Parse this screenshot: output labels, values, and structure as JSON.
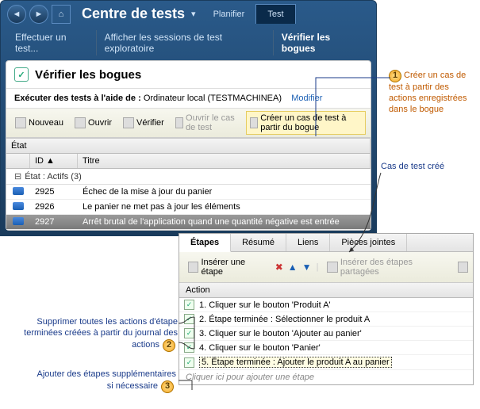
{
  "header": {
    "title": "Centre de tests",
    "tabs": [
      "Planifier",
      "Test"
    ],
    "active_tab": "Test"
  },
  "subnav": {
    "items": [
      "Effectuer un test...",
      "Afficher les sessions de test exploratoire",
      "Vérifier les bogues"
    ],
    "active": "Vérifier les bogues"
  },
  "panel": {
    "title": "Vérifier les bogues",
    "run_label": "Exécuter des tests à l'aide de :",
    "run_value": "Ordinateur local (TESTMACHINEA)",
    "modify": "Modifier"
  },
  "toolbar": {
    "new": "Nouveau",
    "open": "Ouvrir",
    "verify": "Vérifier",
    "open_case": "Ouvrir le cas de test",
    "create_case": "Créer un cas de test à partir du bogue"
  },
  "grid": {
    "state_hdr": "État",
    "cols": [
      "",
      "ID",
      "Titre"
    ],
    "group": "État : Actifs (3)",
    "rows": [
      {
        "id": "2925",
        "title": "Échec de la mise à jour du panier"
      },
      {
        "id": "2926",
        "title": "Le panier ne met pas à jour les éléments"
      },
      {
        "id": "2927",
        "title": "Arrêt brutal de l'application quand une quantité négative est entrée"
      }
    ],
    "selected": 2
  },
  "detail": {
    "tabs": [
      "Étapes",
      "Résumé",
      "Liens",
      "Pièces jointes"
    ],
    "active": "Étapes",
    "toolbar": {
      "insert_step": "Insérer une étape",
      "insert_shared": "Insérer des étapes partagées"
    },
    "action_hdr": "Action",
    "steps": [
      "1. Cliquer sur le bouton 'Produit A'",
      "2. Étape terminée : Sélectionner le produit A",
      "3. Cliquer sur le bouton 'Ajouter au panier'",
      "4. Cliquer sur le bouton 'Panier'",
      "5. Étape terminée : Ajouter le produit A au panier"
    ],
    "selected": 4,
    "placeholder": "Cliquer ici pour ajouter une étape"
  },
  "annotations": {
    "a1": "Créer un cas de test à partir des actions enregistrées dans le bogue",
    "case_created": "Cas de test créé",
    "a2": "Supprimer toutes les actions d'étape terminées créées à partir du journal des actions",
    "a3": "Ajouter des étapes supplémentaires si nécessaire"
  }
}
